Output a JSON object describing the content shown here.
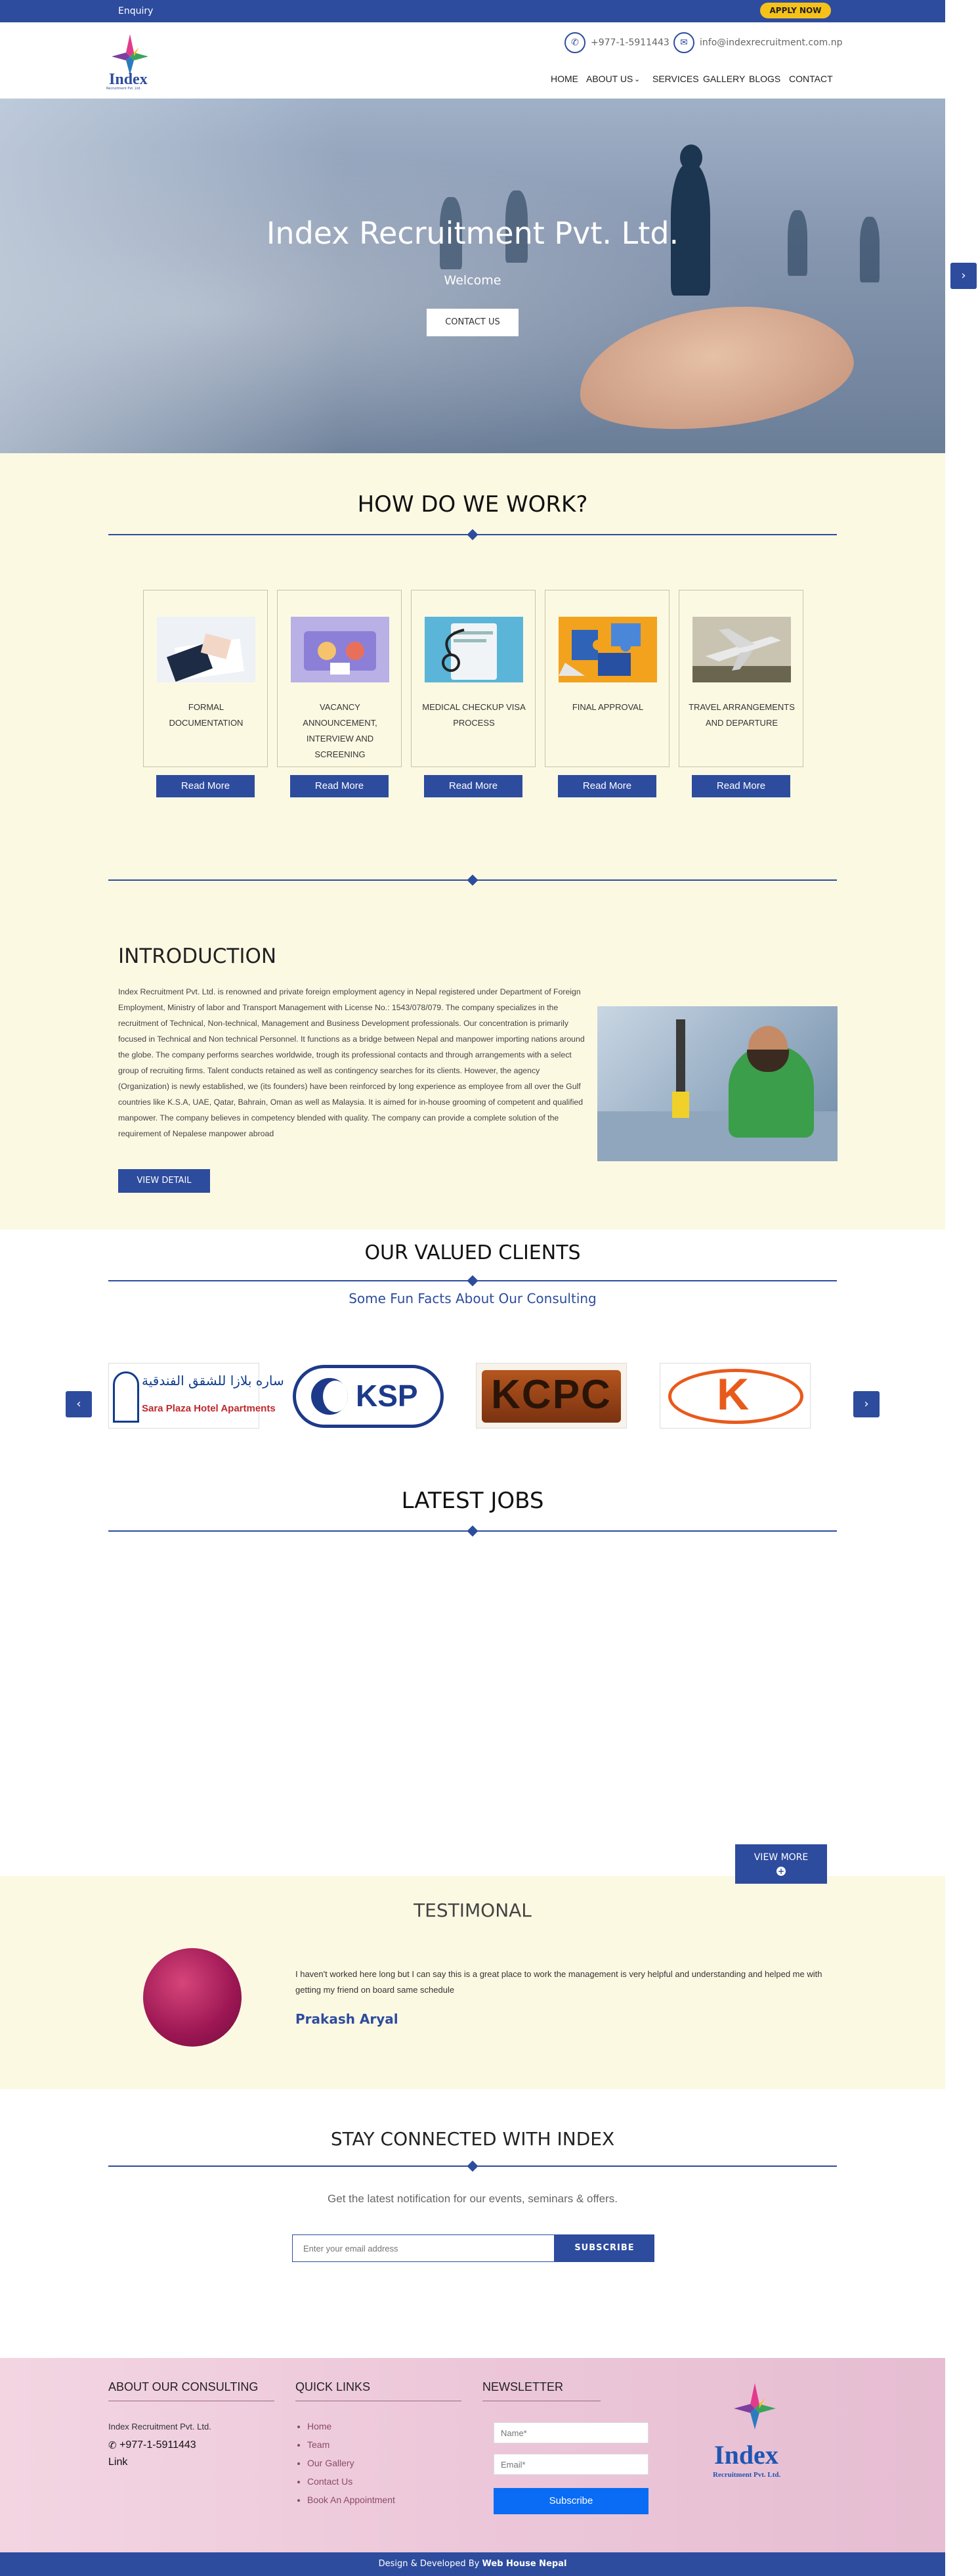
{
  "topbar": {
    "enquiry": "Enquiry",
    "apply": "APPLY NOW"
  },
  "header": {
    "phone": "+977-1-5911443",
    "email": "info@indexrecruitment.com.np",
    "logo_text": "Index",
    "logo_sub": "Recruitment Pvt. Ltd."
  },
  "nav": {
    "home": "HOME",
    "about": "ABOUT US",
    "services": "SERVICES",
    "gallery": "GALLERY",
    "blogs": "BLOGS",
    "contact": "CONTACT"
  },
  "hero": {
    "title": "Index Recruitment Pvt. Ltd.",
    "welcome": "Welcome",
    "button": "CONTACT US"
  },
  "work": {
    "title": "HOW DO WE WORK?",
    "read_more": "Read More",
    "steps": [
      {
        "label": "FORMAL DOCUMENTATION",
        "icon": "documents-icon"
      },
      {
        "label": "VACANCY ANNOUNCEMENT, INTERVIEW AND SCREENING",
        "icon": "interview-icon"
      },
      {
        "label": "MEDICAL CHECKUP VISA PROCESS",
        "icon": "stethoscope-icon"
      },
      {
        "label": "FINAL APPROVAL",
        "icon": "puzzle-icon"
      },
      {
        "label": "TRAVEL ARRANGEMENTS AND DEPARTURE",
        "icon": "airplane-icon"
      }
    ]
  },
  "intro": {
    "title": "INTRODUCTION",
    "text": "Index Recruitment Pvt. Ltd. is renowned and private foreign employment agency in Nepal registered under Department of Foreign Employment, Ministry of labor and Transport Management with License No.: 1543/078/079. The company specializes in the recruitment of Technical, Non-technical, Management and Business Development professionals. Our concentration is primarily focused in Technical and Non technical Personnel. It functions as a bridge between Nepal and manpower importing nations around the globe. The company performs searches worldwide, trough its professional contacts and through arrangements with a select group of recruiting firms. Talent conducts retained as well as contingency searches for its clients. However, the agency (Organization) is newly established, we (its founders) have been reinforced by long experience as employee from all over the Gulf countries like K.S.A, UAE, Qatar, Bahrain, Oman as well as Malaysia. It is aimed for in-house grooming of competent and qualified manpower. The company believes in competency blended with quality. The company can provide a complete solution of the requirement of Nepalese manpower abroad",
    "button": "VIEW DETAIL"
  },
  "clients": {
    "title": "OUR VALUED CLIENTS",
    "subtitle": "Some Fun Facts About Our Consulting",
    "logos": [
      {
        "arabic": "ساره بلازا للشقق الفندقية",
        "name": "Sara Plaza Hotel Apartments"
      },
      {
        "name": "KSP"
      },
      {
        "name": "KCPC"
      },
      {
        "name": "K"
      }
    ]
  },
  "jobs": {
    "title": "LATEST JOBS",
    "view_more": "VIEW MORE"
  },
  "testimonial": {
    "title": "TESTIMONAL",
    "quote": "I haven't worked here long but I can say this is a great place to work the management is very helpful and understanding and helped me with getting my friend on board same schedule",
    "author": "Prakash Aryal"
  },
  "newsletter": {
    "title": "STAY CONNECTED WITH INDEX",
    "subtitle": "Get the latest notification for our events, seminars & offers.",
    "placeholder": "Enter your email address",
    "button": "SUBSCRIBE"
  },
  "footer": {
    "about_title": "ABOUT OUR CONSULTING",
    "company": "Index Recruitment Pvt. Ltd.",
    "phone": "+977-1-5911443",
    "link": "Link",
    "quick_title": "QUICK LINKS",
    "links": [
      "Home",
      "Team",
      "Our Gallery",
      "Contact Us",
      "Book An Appointment"
    ],
    "news_title": "NEWSLETTER",
    "name_placeholder": "Name*",
    "email_placeholder": "Email*",
    "subscribe": "Subscribe",
    "logo_text": "Index",
    "logo_sub": "Recruitment Pvt. Ltd."
  },
  "bottom": {
    "prefix": "Design & Developed By ",
    "dev": "Web House Nepal"
  },
  "colors": {
    "primary": "#2d4c9e",
    "accent": "#f6c21a",
    "cream": "#fcf9e3"
  }
}
